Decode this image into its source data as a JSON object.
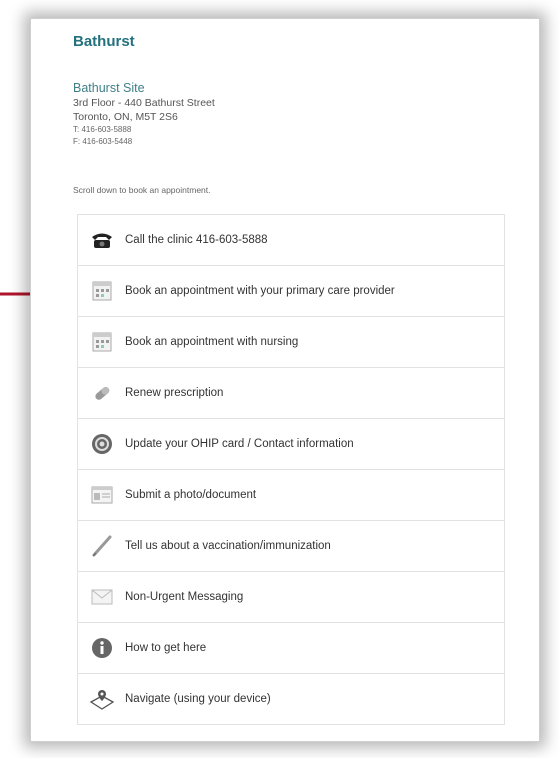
{
  "page": {
    "title": "Bathurst",
    "site_name": "Bathurst Site",
    "address_line1": "3rd Floor - 440 Bathurst Street",
    "address_line2": "Toronto, ON, M5T 2S6",
    "phone": "T: 416-603-5888",
    "fax": "F: 416-603-5448",
    "scroll_note": "Scroll down to book an appointment."
  },
  "menu": [
    {
      "label": "Call the clinic 416-603-5888",
      "icon": "phone-icon"
    },
    {
      "label": "Book an appointment with your primary care provider",
      "icon": "calendar-icon"
    },
    {
      "label": "Book an appointment with nursing",
      "icon": "calendar-icon"
    },
    {
      "label": "Renew prescription",
      "icon": "pill-icon"
    },
    {
      "label": "Update your OHIP card / Contact information",
      "icon": "card-icon"
    },
    {
      "label": "Submit a photo/document",
      "icon": "document-icon"
    },
    {
      "label": "Tell us about a vaccination/immunization",
      "icon": "syringe-icon"
    },
    {
      "label": "Non-Urgent Messaging",
      "icon": "envelope-icon"
    },
    {
      "label": "How to get here",
      "icon": "info-icon"
    },
    {
      "label": "Navigate (using your device)",
      "icon": "map-pin-icon"
    }
  ],
  "colors": {
    "title": "#23717d",
    "arrow": "#b0142a",
    "border": "#e2e2e2"
  }
}
